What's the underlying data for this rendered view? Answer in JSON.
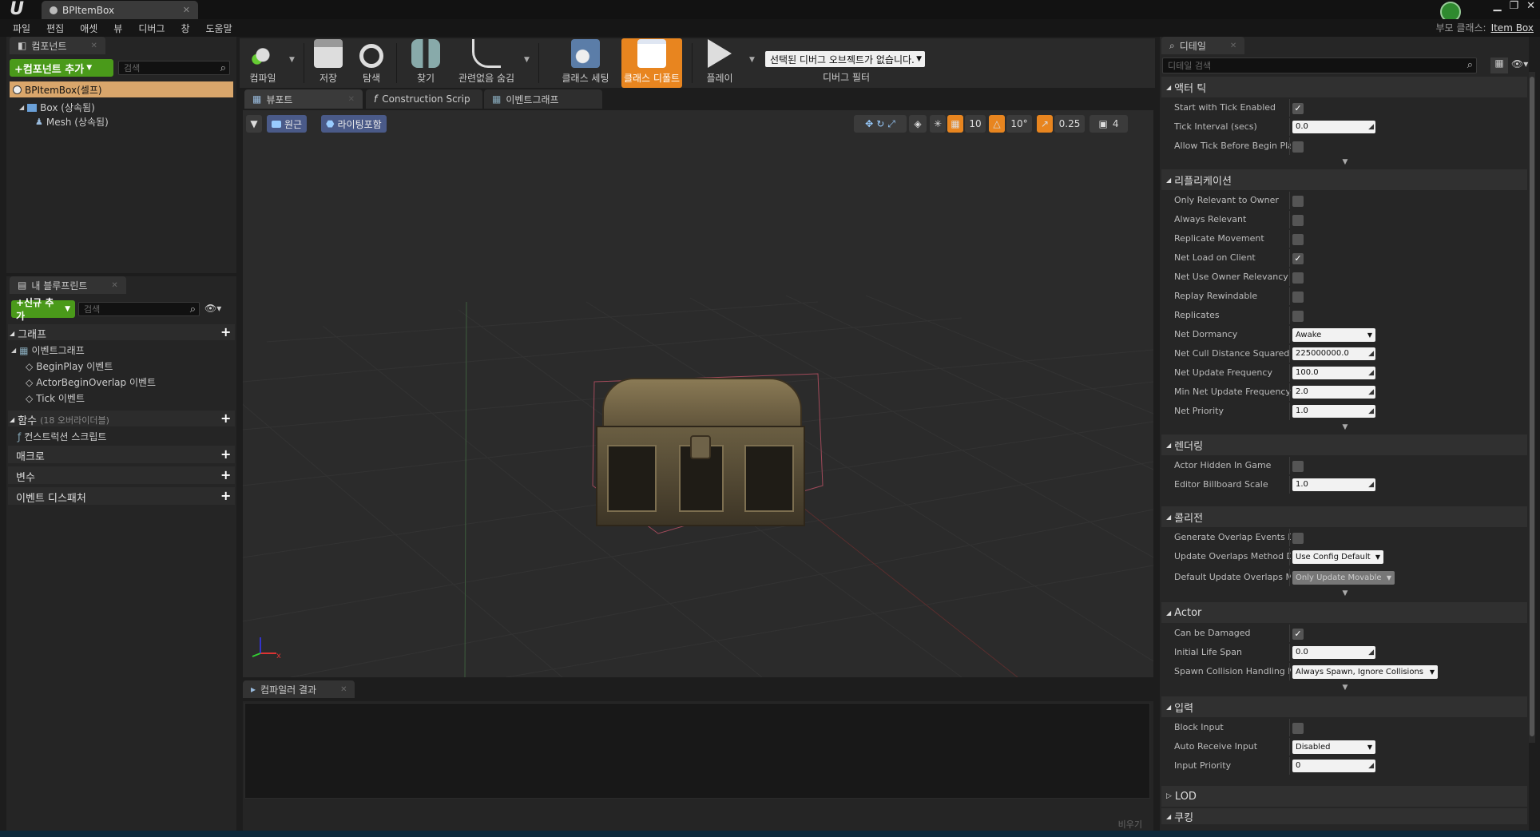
{
  "window": {
    "tab_title": "BPItemBox",
    "parent_class_label": "부모 클래스:",
    "parent_class_value": "Item Box"
  },
  "menu": [
    "파일",
    "편집",
    "애셋",
    "뷰",
    "디버그",
    "창",
    "도움말"
  ],
  "components_panel": {
    "tab_label": "컴포넌트",
    "add_button": "+컴포넌트 추가",
    "search_placeholder": "검색",
    "root": "BPItemBox(셀프)",
    "items": [
      "Box (상속됨)",
      "Mesh (상속됨)"
    ]
  },
  "my_blueprint_panel": {
    "tab_label": "내 블루프린트",
    "add_button": "+신규 추가",
    "search_placeholder": "검색",
    "graph_section": "그래프",
    "event_graph": "이벤트그래프",
    "events": [
      "BeginPlay 이벤트",
      "ActorBeginOverlap 이벤트",
      "Tick 이벤트"
    ],
    "functions_section": "함수",
    "functions_count": "(18 오버라이더블)",
    "construction_script": "컨스트럭션 스크립트",
    "macros_section": "매크로",
    "variables_section": "변수",
    "dispatchers_section": "이벤트 디스패처"
  },
  "toolbar": {
    "compile": "컴파일",
    "save": "저장",
    "browse": "탐색",
    "find": "찾기",
    "hide_unrelated": "관련없음 숨김",
    "class_settings": "클래스 세팅",
    "class_defaults": "클래스 디폴트",
    "play": "플레이",
    "debug_object": "선택된 디버그 오브젝트가 없습니다.",
    "debug_filter": "디버그 필터"
  },
  "editor_tabs": [
    "뷰포트",
    "Construction Scrip",
    "이벤트그래프"
  ],
  "viewport": {
    "perspective": "원근",
    "lighting": "라이팅포함",
    "grid_snap": "10",
    "rot_snap": "10°",
    "scale_snap": "0.25",
    "camera_speed": "4"
  },
  "compiler_results": {
    "tab_label": "컴파일러 결과",
    "clear": "비우기"
  },
  "details": {
    "tab_label": "디테일",
    "search_placeholder": "디테일 검색",
    "categories": {
      "actor_tick": "액터 틱",
      "replication": "리플리케이션",
      "rendering": "렌더링",
      "collision": "콜리전",
      "actor": "Actor",
      "input": "입력",
      "lod": "LOD",
      "cooking": "쿠킹"
    },
    "props": {
      "start_with_tick": {
        "name": "Start with Tick Enabled",
        "checked": true
      },
      "tick_interval": {
        "name": "Tick Interval (secs)",
        "value": "0.0"
      },
      "allow_tick_before_play": {
        "name": "Allow Tick Before Begin Play",
        "checked": false
      },
      "only_relevant_owner": {
        "name": "Only Relevant to Owner",
        "checked": false
      },
      "always_relevant": {
        "name": "Always Relevant",
        "checked": false
      },
      "replicate_movement": {
        "name": "Replicate Movement",
        "checked": false
      },
      "net_load_on_client": {
        "name": "Net Load on Client",
        "checked": true
      },
      "net_use_owner_relevancy": {
        "name": "Net Use Owner Relevancy",
        "checked": false
      },
      "replay_rewindable": {
        "name": "Replay Rewindable",
        "checked": false
      },
      "replicates": {
        "name": "Replicates",
        "checked": false
      },
      "net_dormancy": {
        "name": "Net Dormancy",
        "value": "Awake"
      },
      "net_cull_distance": {
        "name": "Net Cull Distance Squared",
        "value": "225000000.0"
      },
      "net_update_freq": {
        "name": "Net Update Frequency",
        "value": "100.0"
      },
      "min_net_update_freq": {
        "name": "Min Net Update Frequency",
        "value": "2.0"
      },
      "net_priority": {
        "name": "Net Priority",
        "value": "1.0"
      },
      "actor_hidden": {
        "name": "Actor Hidden In Game",
        "checked": false
      },
      "billboard_scale": {
        "name": "Editor Billboard Scale",
        "value": "1.0"
      },
      "gen_overlap_events": {
        "name": "Generate Overlap Events Dur",
        "checked": false
      },
      "update_overlaps_method": {
        "name": "Update Overlaps Method Dur",
        "value": "Use Config Default"
      },
      "default_update_overlaps": {
        "name": "Default Update Overlaps Met",
        "value": "Only Update Movable"
      },
      "can_be_damaged": {
        "name": "Can be Damaged",
        "checked": true
      },
      "initial_life_span": {
        "name": "Initial Life Span",
        "value": "0.0"
      },
      "spawn_collision": {
        "name": "Spawn Collision Handling Me",
        "value": "Always Spawn, Ignore Collisions"
      },
      "block_input": {
        "name": "Block Input",
        "checked": false
      },
      "auto_receive_input": {
        "name": "Auto Receive Input",
        "value": "Disabled"
      },
      "input_priority": {
        "name": "Input Priority",
        "value": "0"
      }
    }
  },
  "colors": {
    "accent_orange": "#e8851f",
    "add_green": "#4a9a1a",
    "selection": "#d9a66b"
  }
}
